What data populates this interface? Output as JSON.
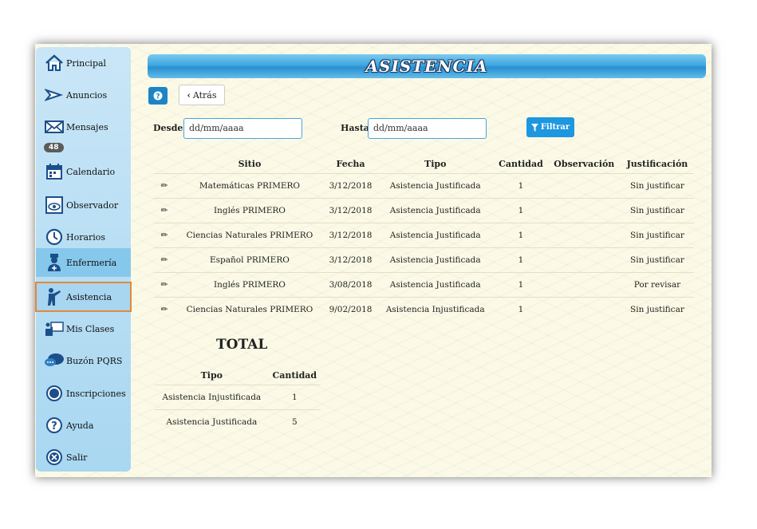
{
  "sidebar": {
    "items": [
      {
        "label": "Principal",
        "icon": "home-icon"
      },
      {
        "label": "Anuncios",
        "icon": "megaphone-icon"
      },
      {
        "label": "Mensajes",
        "icon": "envelope-icon",
        "badge": "48"
      },
      {
        "label": "Calendario",
        "icon": "calendar-icon"
      },
      {
        "label": "Observador",
        "icon": "eye-icon"
      },
      {
        "label": "Horarios",
        "icon": "clock-icon"
      },
      {
        "label": "Enfermería",
        "icon": "nurse-icon"
      },
      {
        "label": "Asistencia",
        "icon": "attendance-person-icon"
      },
      {
        "label": "Mis Clases",
        "icon": "teacher-board-icon"
      },
      {
        "label": "Buzón PQRS",
        "icon": "speech-bubble-icon"
      },
      {
        "label": "Inscripciones",
        "icon": "radio-circle-icon"
      },
      {
        "label": "Ayuda",
        "icon": "question-circle-icon"
      },
      {
        "label": "Salir",
        "icon": "close-circle-icon"
      }
    ],
    "active": "Asistencia"
  },
  "header": {
    "title": "ASISTENCIA"
  },
  "toolbar": {
    "back_label": "Atrás"
  },
  "filters": {
    "desde_label": "Desde",
    "desde_value": "dd/mm/aaaa",
    "hasta_label": "Hasta",
    "hasta_value": "dd/mm/aaaa",
    "filter_label": "Filtrar"
  },
  "table": {
    "columns": [
      "Sitio",
      "Fecha",
      "Tipo",
      "Cantidad",
      "Observación",
      "Justificación"
    ],
    "rows": [
      {
        "sitio": "Matemáticas PRIMERO",
        "fecha": "3/12/2018",
        "tipo": "Asistencia Justificada",
        "cantidad": "1",
        "observacion": "",
        "justificacion": "Sin justificar"
      },
      {
        "sitio": "Inglés PRIMERO",
        "fecha": "3/12/2018",
        "tipo": "Asistencia Justificada",
        "cantidad": "1",
        "observacion": "",
        "justificacion": "Sin justificar"
      },
      {
        "sitio": "Ciencias Naturales PRIMERO",
        "fecha": "3/12/2018",
        "tipo": "Asistencia Justificada",
        "cantidad": "1",
        "observacion": "",
        "justificacion": "Sin justificar"
      },
      {
        "sitio": "Español PRIMERO",
        "fecha": "3/12/2018",
        "tipo": "Asistencia Justificada",
        "cantidad": "1",
        "observacion": "",
        "justificacion": "Sin justificar"
      },
      {
        "sitio": "Inglés PRIMERO",
        "fecha": "3/08/2018",
        "tipo": "Asistencia Justificada",
        "cantidad": "1",
        "observacion": "",
        "justificacion": "Por revisar"
      },
      {
        "sitio": "Ciencias Naturales PRIMERO",
        "fecha": "9/02/2018",
        "tipo": "Asistencia Injustificada",
        "cantidad": "1",
        "observacion": "",
        "justificacion": "Sin justificar"
      }
    ]
  },
  "total": {
    "title": "TOTAL",
    "columns": [
      "Tipo",
      "Cantidad"
    ],
    "rows": [
      {
        "tipo": "Asistencia Injustificada",
        "cantidad": "1"
      },
      {
        "tipo": "Asistencia Justificada",
        "cantidad": "5"
      }
    ]
  },
  "colors": {
    "accent": "#1c97e0",
    "active_outline": "#e2893a",
    "background": "#fcfae6"
  }
}
